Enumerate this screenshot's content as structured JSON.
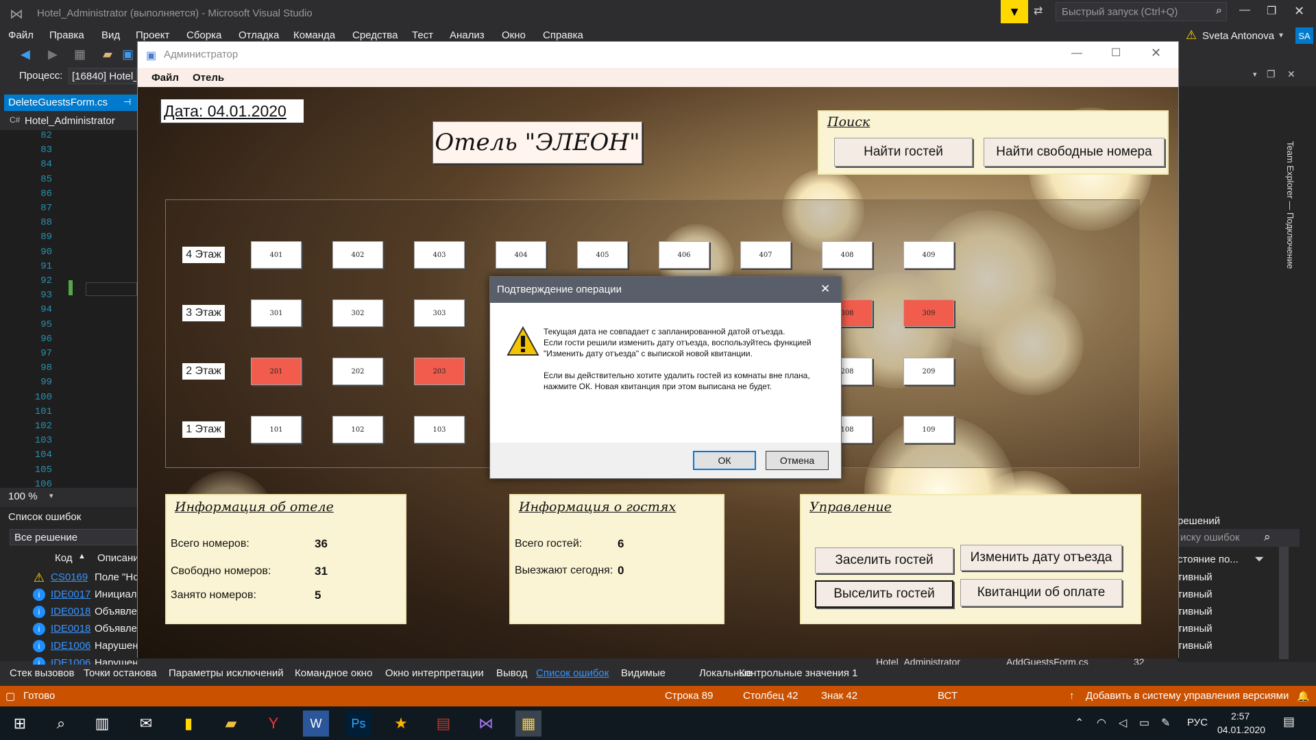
{
  "vs": {
    "title": "Hotel_Administrator (выполняется) - Microsoft Visual Studio",
    "quick_launch": "Быстрый запуск (Ctrl+Q)",
    "user": "Sveta Antonova",
    "user_initials": "SA",
    "menu": [
      "Файл",
      "Правка",
      "Вид",
      "Проект",
      "Сборка",
      "Отладка",
      "Команда",
      "Средства",
      "Тест",
      "Анализ",
      "Окно",
      "Справка"
    ],
    "process_label": "Процесс:",
    "process_value": "[16840] Hotel_",
    "doc_tab": "DeleteGuestsForm.cs",
    "project": "Hotel_Administrator",
    "line_numbers": [
      "82",
      "83",
      "84",
      "85",
      "86",
      "87",
      "88",
      "89",
      "90",
      "91",
      "92",
      "93",
      "94",
      "95",
      "96",
      "97",
      "98",
      "99",
      "100",
      "101",
      "102",
      "103",
      "104",
      "105",
      "106"
    ],
    "zoom": "100 %",
    "error_list": {
      "title": "Список ошибок",
      "scope": "Все решение",
      "col_code": "Код",
      "col_desc": "Описани",
      "rows": [
        {
          "code": "CS0169",
          "desc": "Поле \"Но",
          "kind": "warning"
        },
        {
          "code": "IDE0017",
          "desc": "Инициал",
          "kind": "info"
        },
        {
          "code": "IDE0018",
          "desc": "Объявле",
          "kind": "info"
        },
        {
          "code": "IDE0018",
          "desc": "Объявле",
          "kind": "info"
        },
        {
          "code": "IDE1006",
          "desc": "Нарушен",
          "kind": "info"
        },
        {
          "code": "IDE1006",
          "desc": "Нарушение правила именования: Эти слова должны начинаться с прописных символов: guestsToAdd_CellClick",
          "kind": "info"
        }
      ]
    },
    "right_panel": {
      "solution": "решений",
      "search": "иску ошибок",
      "state_header": "стояние по...",
      "states": [
        "тивный",
        "тивный",
        "тивный",
        "тивный",
        "тивный"
      ],
      "vertical_text": "Team Explorer — Подключение"
    },
    "hidden_row": {
      "project": "Hotel_Administrator",
      "file": "AddGuestsForm.cs",
      "line": "32",
      "state": "Активный"
    },
    "bottom_tabs": [
      "Стек вызовов",
      "Точки останова",
      "Параметры исключений",
      "Командное окно",
      "Окно интерпретации",
      "Вывод",
      "Список ошибок",
      "Видимые",
      "Локальные",
      "Контрольные значения 1"
    ],
    "status": {
      "ready": "Готово",
      "line": "Строка 89",
      "col": "Столбец 42",
      "char": "Знак 42",
      "mode": "ВСТ",
      "vcs": "Добавить в систему управления версиями",
      "badge": "2"
    }
  },
  "taskbar": {
    "lang": "РУС",
    "time": "2:57",
    "date": "04.01.2020",
    "notif": "1"
  },
  "app": {
    "title": "Администратор",
    "menu": [
      "Файл",
      "Отель"
    ],
    "date_label": "Дата: 04.01.2020",
    "hotel_name": "Отель \"ЭЛЕОН\"",
    "search": {
      "title": "Поиск",
      "find_guests": "Найти гостей",
      "find_rooms": "Найти свободные номера"
    },
    "floors": [
      {
        "label": "4 Этаж",
        "rooms": [
          {
            "n": "401",
            "occ": false
          },
          {
            "n": "402",
            "occ": false
          },
          {
            "n": "403",
            "occ": false
          },
          {
            "n": "404",
            "occ": false
          },
          {
            "n": "405",
            "occ": false
          },
          {
            "n": "406",
            "occ": false
          },
          {
            "n": "407",
            "occ": false
          },
          {
            "n": "408",
            "occ": false
          },
          {
            "n": "409",
            "occ": false
          }
        ]
      },
      {
        "label": "3 Этаж",
        "rooms": [
          {
            "n": "301",
            "occ": false
          },
          {
            "n": "302",
            "occ": false
          },
          {
            "n": "303",
            "occ": false
          },
          {
            "n": "",
            "occ": false
          },
          {
            "n": "",
            "occ": false
          },
          {
            "n": "",
            "occ": false
          },
          {
            "n": "",
            "occ": false
          },
          {
            "n": "308",
            "occ": true
          },
          {
            "n": "309",
            "occ": true
          }
        ]
      },
      {
        "label": "2 Этаж",
        "rooms": [
          {
            "n": "201",
            "occ": true
          },
          {
            "n": "202",
            "occ": false
          },
          {
            "n": "203",
            "occ": true
          },
          {
            "n": "",
            "occ": false
          },
          {
            "n": "",
            "occ": false
          },
          {
            "n": "",
            "occ": false
          },
          {
            "n": "",
            "occ": false
          },
          {
            "n": "208",
            "occ": false
          },
          {
            "n": "209",
            "occ": false
          }
        ]
      },
      {
        "label": "1 Этаж",
        "rooms": [
          {
            "n": "101",
            "occ": false
          },
          {
            "n": "102",
            "occ": false
          },
          {
            "n": "103",
            "occ": false
          },
          {
            "n": "",
            "occ": false
          },
          {
            "n": "",
            "occ": false
          },
          {
            "n": "",
            "occ": false
          },
          {
            "n": "",
            "occ": false
          },
          {
            "n": "108",
            "occ": false
          },
          {
            "n": "109",
            "occ": false
          }
        ]
      }
    ],
    "hotel_info": {
      "title": "Информация об отеле",
      "total_label": "Всего номеров:",
      "total": "36",
      "free_label": "Свободно номеров:",
      "free": "31",
      "busy_label": "Занято номеров:",
      "busy": "5"
    },
    "guest_info": {
      "title": "Информация о гостях",
      "total_label": "Всего гостей:",
      "total": "6",
      "leaving_label": "Выезжают сегодня:",
      "leaving": "0"
    },
    "control": {
      "title": "Управление",
      "checkin": "Заселить гостей",
      "change_date": "Изменить дату отъезда",
      "checkout": "Выселить гостей",
      "receipts": "Квитанции об оплате"
    }
  },
  "dialog": {
    "title": "Подтверждение операции",
    "p1": "Текущая дата не совпадает с запланированной датой отъезда.",
    "p2": "Если гости решили изменить дату отъезда, воспользуйтесь функцией \"Изменить дату отъезда\" с выпиской новой квитанции.",
    "p3": "Если вы действительно хотите удалить гостей из комнаты вне плана, нажмите ОК. Новая квитанция при этом выписана не будет.",
    "ok": "ОК",
    "cancel": "Отмена"
  }
}
